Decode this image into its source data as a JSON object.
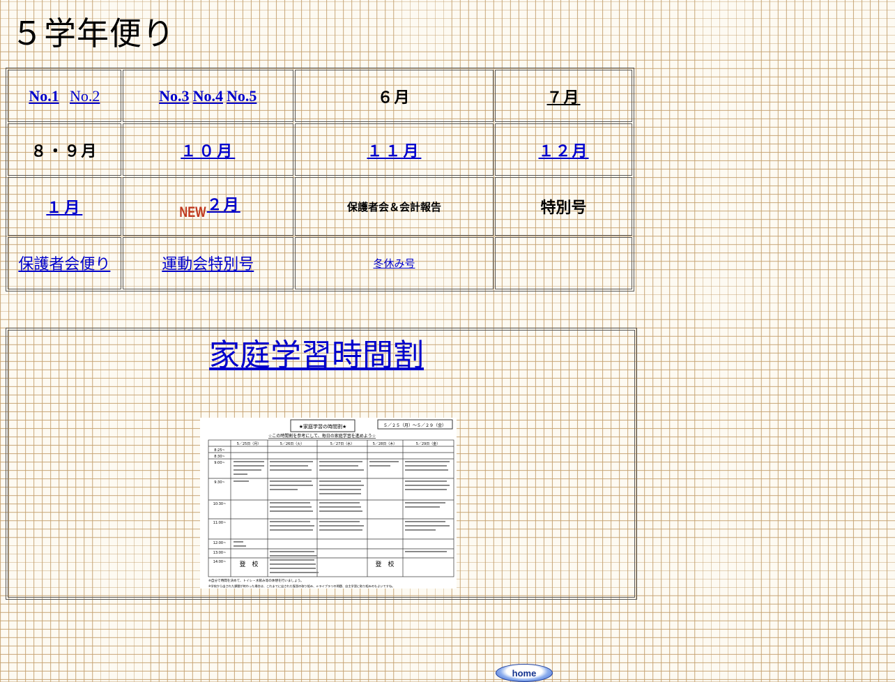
{
  "title": "５学年便り",
  "nav": {
    "row1": {
      "no1": "No.1",
      "no2": "No.2",
      "no3": "No.3",
      "no4": "No.4",
      "no5": "No.5",
      "june": "６月",
      "july": "７月"
    },
    "row2": {
      "aug_sep": "８・９月",
      "oct": "１０月",
      "nov": "１１月",
      "dec": "１２月"
    },
    "row3": {
      "jan": "１月",
      "new_badge": "NEW",
      "feb": "２月",
      "pta_report": "保護者会＆会計報告",
      "special": "特別号"
    },
    "row4": {
      "pta_letter": "保護者会便り",
      "sports_day": "運動会特別号",
      "winter": "冬休み号"
    }
  },
  "study": {
    "title": "家庭学習時間割",
    "image": {
      "header": "★家庭学習の時間割★",
      "period": "５／２５（月）～５／２９（金）",
      "subheader": "☆この時間割を参考にして、毎日の家庭学習を進めよう☆",
      "days": [
        "5／25日（月）",
        "5／26日（火）",
        "5／27日（水）",
        "5／28日（木）",
        "5／29日（金）"
      ],
      "times": [
        "8:25~",
        "8:30~",
        "9:00~",
        "9:30~",
        "10:30~",
        "11:00~",
        "12:00~",
        "13:00~",
        "14:00~"
      ],
      "attend": "登　校",
      "note1": "※自分で時間を決めて、トイレ・水飲み等の休憩を行いましょう。",
      "note2": "※学校から出された課題が終わった場合は、これまでに出された復習の取り組み、ｅライブラリの問題、自主学習に取り組みのもよいですね。"
    }
  },
  "home_button": "home"
}
